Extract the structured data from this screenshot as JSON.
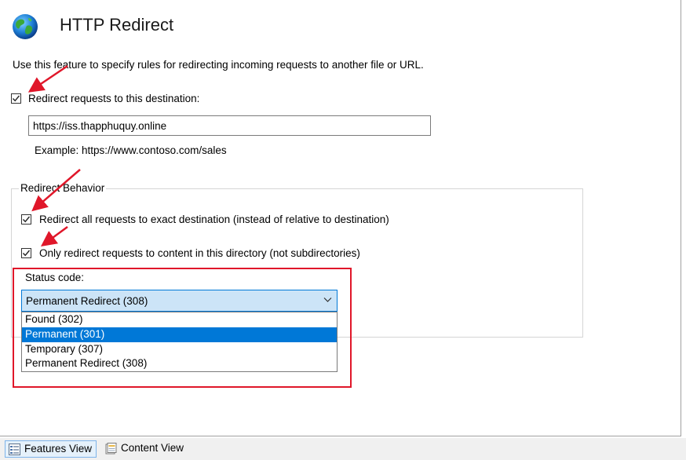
{
  "header": {
    "title": "HTTP Redirect",
    "icon": "globe-icon"
  },
  "description": "Use this feature to specify rules for redirecting incoming requests to another file or URL.",
  "redirect": {
    "enabled_label": "Redirect requests to this destination:",
    "enabled": true,
    "destination_value": "https://iss.thapphuquy.online",
    "example": "Example: https://www.contoso.com/sales"
  },
  "behavior": {
    "legend": "Redirect Behavior",
    "exact_label": "Redirect all requests to exact destination (instead of relative to destination)",
    "exact_checked": true,
    "only_dir_label": "Only redirect requests to content in this directory (not subdirectories)",
    "only_dir_checked": true,
    "status_label": "Status code:",
    "status_selected": "Permanent Redirect (308)",
    "status_options": [
      "Found (302)",
      "Permanent (301)",
      "Temporary (307)",
      "Permanent Redirect (308)"
    ],
    "highlighted_option": "Permanent (301)"
  },
  "statusbar": {
    "features_view": "Features View",
    "content_view": "Content View"
  },
  "colors": {
    "accent": "#0078d7",
    "annotation_red": "#e0172a",
    "select_bg": "#cce4f7"
  }
}
